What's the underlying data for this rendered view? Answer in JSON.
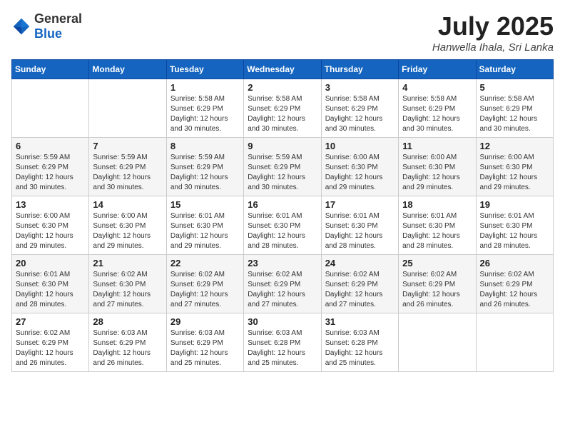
{
  "header": {
    "logo": {
      "text_general": "General",
      "text_blue": "Blue"
    },
    "title": "July 2025",
    "location": "Hanwella Ihala, Sri Lanka"
  },
  "weekdays": [
    "Sunday",
    "Monday",
    "Tuesday",
    "Wednesday",
    "Thursday",
    "Friday",
    "Saturday"
  ],
  "weeks": [
    [
      {
        "day": "",
        "info": ""
      },
      {
        "day": "",
        "info": ""
      },
      {
        "day": "1",
        "info": "Sunrise: 5:58 AM\nSunset: 6:29 PM\nDaylight: 12 hours\nand 30 minutes."
      },
      {
        "day": "2",
        "info": "Sunrise: 5:58 AM\nSunset: 6:29 PM\nDaylight: 12 hours\nand 30 minutes."
      },
      {
        "day": "3",
        "info": "Sunrise: 5:58 AM\nSunset: 6:29 PM\nDaylight: 12 hours\nand 30 minutes."
      },
      {
        "day": "4",
        "info": "Sunrise: 5:58 AM\nSunset: 6:29 PM\nDaylight: 12 hours\nand 30 minutes."
      },
      {
        "day": "5",
        "info": "Sunrise: 5:58 AM\nSunset: 6:29 PM\nDaylight: 12 hours\nand 30 minutes."
      }
    ],
    [
      {
        "day": "6",
        "info": "Sunrise: 5:59 AM\nSunset: 6:29 PM\nDaylight: 12 hours\nand 30 minutes."
      },
      {
        "day": "7",
        "info": "Sunrise: 5:59 AM\nSunset: 6:29 PM\nDaylight: 12 hours\nand 30 minutes."
      },
      {
        "day": "8",
        "info": "Sunrise: 5:59 AM\nSunset: 6:29 PM\nDaylight: 12 hours\nand 30 minutes."
      },
      {
        "day": "9",
        "info": "Sunrise: 5:59 AM\nSunset: 6:29 PM\nDaylight: 12 hours\nand 30 minutes."
      },
      {
        "day": "10",
        "info": "Sunrise: 6:00 AM\nSunset: 6:30 PM\nDaylight: 12 hours\nand 29 minutes."
      },
      {
        "day": "11",
        "info": "Sunrise: 6:00 AM\nSunset: 6:30 PM\nDaylight: 12 hours\nand 29 minutes."
      },
      {
        "day": "12",
        "info": "Sunrise: 6:00 AM\nSunset: 6:30 PM\nDaylight: 12 hours\nand 29 minutes."
      }
    ],
    [
      {
        "day": "13",
        "info": "Sunrise: 6:00 AM\nSunset: 6:30 PM\nDaylight: 12 hours\nand 29 minutes."
      },
      {
        "day": "14",
        "info": "Sunrise: 6:00 AM\nSunset: 6:30 PM\nDaylight: 12 hours\nand 29 minutes."
      },
      {
        "day": "15",
        "info": "Sunrise: 6:01 AM\nSunset: 6:30 PM\nDaylight: 12 hours\nand 29 minutes."
      },
      {
        "day": "16",
        "info": "Sunrise: 6:01 AM\nSunset: 6:30 PM\nDaylight: 12 hours\nand 28 minutes."
      },
      {
        "day": "17",
        "info": "Sunrise: 6:01 AM\nSunset: 6:30 PM\nDaylight: 12 hours\nand 28 minutes."
      },
      {
        "day": "18",
        "info": "Sunrise: 6:01 AM\nSunset: 6:30 PM\nDaylight: 12 hours\nand 28 minutes."
      },
      {
        "day": "19",
        "info": "Sunrise: 6:01 AM\nSunset: 6:30 PM\nDaylight: 12 hours\nand 28 minutes."
      }
    ],
    [
      {
        "day": "20",
        "info": "Sunrise: 6:01 AM\nSunset: 6:30 PM\nDaylight: 12 hours\nand 28 minutes."
      },
      {
        "day": "21",
        "info": "Sunrise: 6:02 AM\nSunset: 6:30 PM\nDaylight: 12 hours\nand 27 minutes."
      },
      {
        "day": "22",
        "info": "Sunrise: 6:02 AM\nSunset: 6:29 PM\nDaylight: 12 hours\nand 27 minutes."
      },
      {
        "day": "23",
        "info": "Sunrise: 6:02 AM\nSunset: 6:29 PM\nDaylight: 12 hours\nand 27 minutes."
      },
      {
        "day": "24",
        "info": "Sunrise: 6:02 AM\nSunset: 6:29 PM\nDaylight: 12 hours\nand 27 minutes."
      },
      {
        "day": "25",
        "info": "Sunrise: 6:02 AM\nSunset: 6:29 PM\nDaylight: 12 hours\nand 26 minutes."
      },
      {
        "day": "26",
        "info": "Sunrise: 6:02 AM\nSunset: 6:29 PM\nDaylight: 12 hours\nand 26 minutes."
      }
    ],
    [
      {
        "day": "27",
        "info": "Sunrise: 6:02 AM\nSunset: 6:29 PM\nDaylight: 12 hours\nand 26 minutes."
      },
      {
        "day": "28",
        "info": "Sunrise: 6:03 AM\nSunset: 6:29 PM\nDaylight: 12 hours\nand 26 minutes."
      },
      {
        "day": "29",
        "info": "Sunrise: 6:03 AM\nSunset: 6:29 PM\nDaylight: 12 hours\nand 25 minutes."
      },
      {
        "day": "30",
        "info": "Sunrise: 6:03 AM\nSunset: 6:28 PM\nDaylight: 12 hours\nand 25 minutes."
      },
      {
        "day": "31",
        "info": "Sunrise: 6:03 AM\nSunset: 6:28 PM\nDaylight: 12 hours\nand 25 minutes."
      },
      {
        "day": "",
        "info": ""
      },
      {
        "day": "",
        "info": ""
      }
    ]
  ]
}
